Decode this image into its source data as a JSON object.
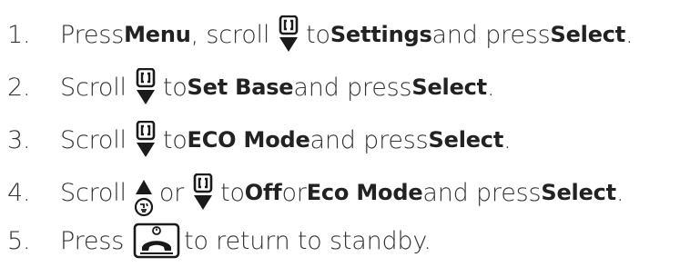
{
  "steps": [
    {
      "number": "1.",
      "parts": [
        "Press ",
        "Menu",
        ", scroll ",
        " to ",
        "Settings",
        " and press ",
        "Select",
        "."
      ],
      "icons": [
        "scroll-down-icon"
      ]
    },
    {
      "number": "2.",
      "parts": [
        "Scroll ",
        " to ",
        "Set Base",
        " and press ",
        "Select",
        "."
      ],
      "icons": [
        "scroll-down-icon"
      ]
    },
    {
      "number": "3.",
      "parts": [
        "Scroll ",
        " to ",
        "ECO Mode",
        " and press ",
        "Select",
        "."
      ],
      "icons": [
        "scroll-down-icon"
      ]
    },
    {
      "number": "4.",
      "parts": [
        "Scroll ",
        " or ",
        " to ",
        "Off",
        " or ",
        "Eco Mode",
        " and press ",
        "Select",
        "."
      ],
      "icons": [
        "scroll-up-icon",
        "scroll-down-icon"
      ]
    },
    {
      "number": "5.",
      "parts": [
        "Press ",
        " to return to standby."
      ],
      "icons": [
        "end-call-key-icon"
      ]
    }
  ],
  "colors": {
    "text": "#333333",
    "icon": "#1a1a1a"
  }
}
